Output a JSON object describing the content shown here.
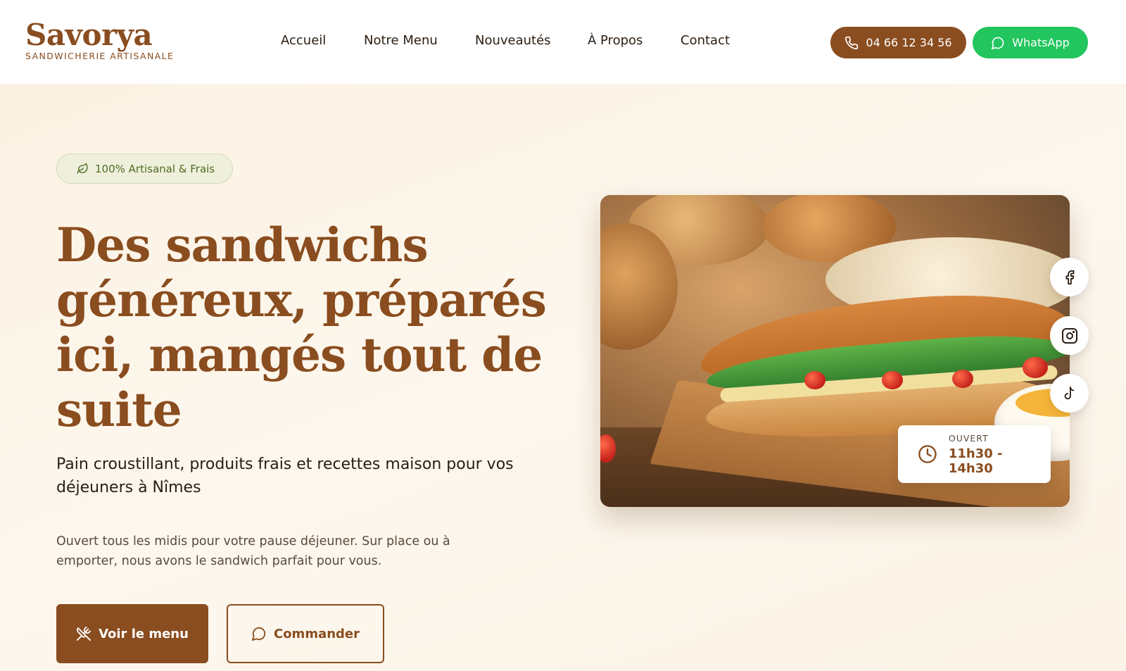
{
  "brand": {
    "name": "Savorya",
    "tagline": "SANDWICHERIE ARTISANALE"
  },
  "nav": {
    "items": [
      "Accueil",
      "Notre Menu",
      "Nouveautés",
      "À Propos",
      "Contact"
    ]
  },
  "header_actions": {
    "phone_label": "04 66 12 34 56",
    "phone_icon": "phone-icon",
    "whatsapp_label": "WhatsApp",
    "whatsapp_icon": "chat-bubble-icon"
  },
  "hero": {
    "badge": "100% Artisanal & Frais",
    "badge_icon": "leaf-icon",
    "headline": "Des sandwichs généreux, préparés ici, mangés tout de suite",
    "subheadline": "Pain croustillant, produits frais et recettes maison pour vos déjeuners à Nîmes",
    "description": "Ouvert tous les midis pour votre pause déjeuner. Sur place ou à emporter, nous avons le sandwich parfait pour vous.",
    "primary_button": "Voir le menu",
    "primary_icon": "utensils-crossed-icon",
    "secondary_button": "Commander",
    "secondary_icon": "chat-bubble-icon"
  },
  "hours_card": {
    "label": "OUVERT",
    "time": "11h30 - 14h30",
    "icon": "clock-icon"
  },
  "social": [
    "facebook-icon",
    "instagram-icon",
    "tiktok-icon"
  ],
  "colors": {
    "brand_brown": "#8a4d1f",
    "whatsapp_green": "#22c55e",
    "badge_green": "#4f6b1f",
    "hero_bg": "#fbf3e6"
  }
}
